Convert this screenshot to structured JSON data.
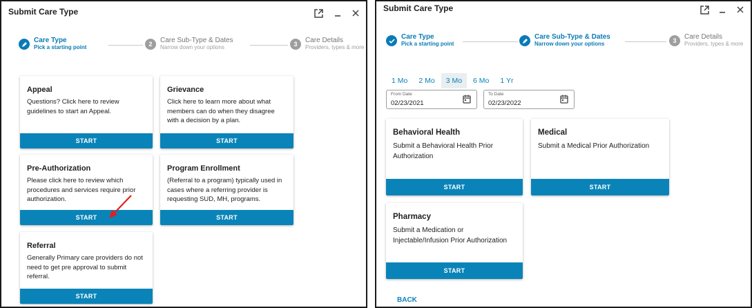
{
  "left_dialog": {
    "title": "Submit Care Type",
    "steps": [
      {
        "number": "",
        "label": "Care Type",
        "sub": "Pick a starting point",
        "state": "active"
      },
      {
        "number": "2",
        "label": "Care Sub-Type & Dates",
        "sub": "Narrow down your options",
        "state": "todo"
      },
      {
        "number": "3",
        "label": "Care Details",
        "sub": "Providers, types & more",
        "state": "todo"
      }
    ],
    "cards": [
      {
        "title": "Appeal",
        "desc": "Questions? Click here to review guidelines to start an Appeal.",
        "button": "START"
      },
      {
        "title": "Grievance",
        "desc": "Click here to learn more about what members can do when they disagree with a decision by a plan.",
        "button": "START"
      },
      {
        "title": "Pre-Authorization",
        "desc": "Please click here to review which procedures and services require prior authorization.",
        "button": "START"
      },
      {
        "title": "Program Enrollment",
        "desc": "(Referral to a program) typically used in cases where a referring provider is requesting SUD, MH, programs.",
        "button": "START"
      },
      {
        "title": "Referral",
        "desc": "Generally Primary care providers do not need to get pre approval to submit referral.",
        "button": "START"
      }
    ]
  },
  "right_dialog": {
    "title": "Submit Care Type",
    "steps": [
      {
        "number": "",
        "label": "Care Type",
        "sub": "Pick a starting point",
        "state": "active"
      },
      {
        "number": "",
        "label": "Care Sub-Type & Dates",
        "sub": "Narrow down your options",
        "state": "active"
      },
      {
        "number": "3",
        "label": "Care Details",
        "sub": "Providers, types & more",
        "state": "todo"
      }
    ],
    "range_tabs": [
      "1 Mo",
      "2 Mo",
      "3 Mo",
      "6 Mo",
      "1 Yr"
    ],
    "selected_range": "3 Mo",
    "from_date": {
      "label": "From Date",
      "value": "02/23/2021"
    },
    "to_date": {
      "label": "To Date",
      "value": "02/23/2022"
    },
    "cards": [
      {
        "title": "Behavioral Health",
        "desc": "Submit a Behavioral Health Prior Authorization",
        "button": "START"
      },
      {
        "title": "Medical",
        "desc": "Submit a Medical Prior Authorization",
        "button": "START"
      },
      {
        "title": "Pharmacy",
        "desc": "Submit a Medication or Injectable/Infusion Prior Authorization",
        "button": "START"
      }
    ],
    "back_label": "BACK"
  },
  "colors": {
    "accent": "#0a84b8",
    "step_active": "#0a7bb5",
    "step_todo": "#9e9e9e",
    "annotation_arrow": "#e0201b"
  }
}
